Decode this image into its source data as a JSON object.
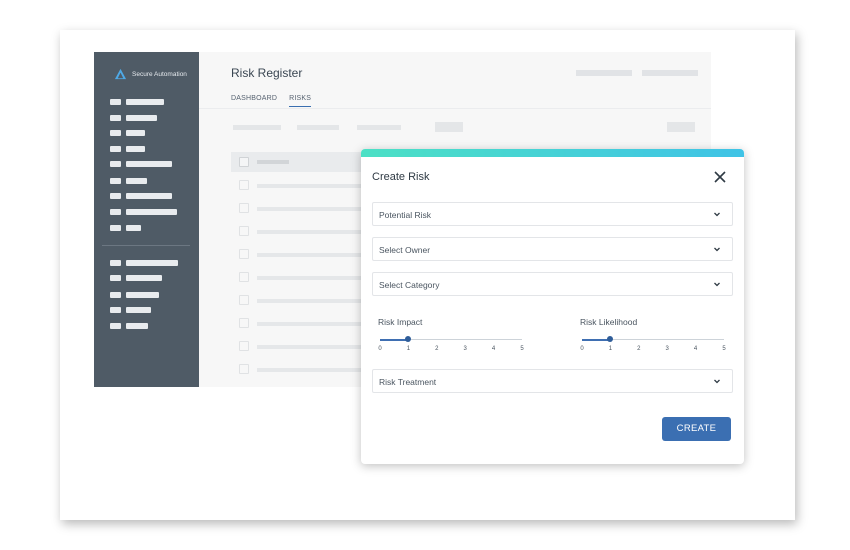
{
  "sidebar": {
    "logo_text": "Secure Automation",
    "nav_groups": [
      {
        "count": 9
      },
      {
        "count": 5
      }
    ]
  },
  "main": {
    "title": "Risk Register",
    "tabs": [
      {
        "label": "DASHBOARD",
        "active": false
      },
      {
        "label": "RISKS",
        "active": true
      }
    ]
  },
  "modal": {
    "title": "Create Risk",
    "fields": {
      "potential_risk": "Potential Risk",
      "select_owner": "Select Owner",
      "select_category": "Select Category",
      "risk_treatment": "Risk Treatment"
    },
    "impact": {
      "label": "Risk Impact",
      "ticks": [
        "0",
        "1",
        "2",
        "3",
        "4",
        "5"
      ],
      "value": 1
    },
    "likelihood": {
      "label": "Risk Likelihood",
      "ticks": [
        "0",
        "1",
        "2",
        "3",
        "4",
        "5"
      ],
      "value": 1
    },
    "create_label": "CREATE"
  },
  "colors": {
    "sidebar": "#4f5b66",
    "accent_start": "#4ce0c5",
    "accent_end": "#3fc3e6",
    "primary": "#3b6fb2"
  },
  "icons": {
    "logo": "logo-icon",
    "close": "close-icon",
    "dropdown": "chevron-down-icon"
  }
}
